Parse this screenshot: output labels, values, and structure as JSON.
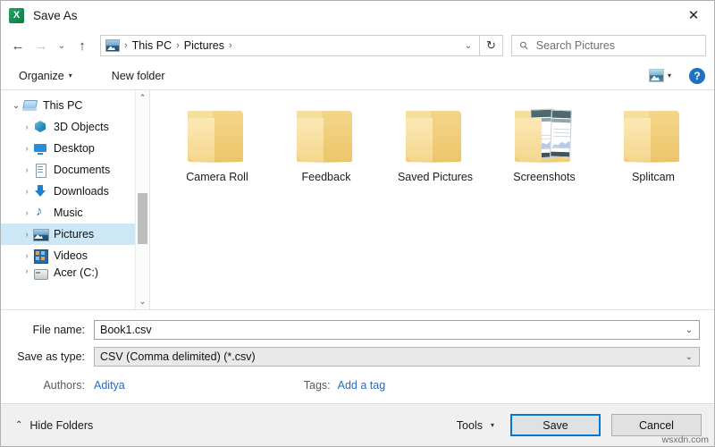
{
  "window": {
    "title": "Save As",
    "app_icon": "excel-icon",
    "close_label": "✕"
  },
  "nav": {
    "back": "←",
    "forward": "→",
    "recent": "⌄",
    "up": "↑",
    "refresh": "↻",
    "address_chevron": "⌄",
    "breadcrumbs": [
      {
        "label": "This PC"
      },
      {
        "label": "Pictures"
      }
    ],
    "separator": "›"
  },
  "search": {
    "placeholder": "Search Pictures",
    "icon": "search-icon"
  },
  "toolbar": {
    "organize_label": "Organize",
    "organize_caret": "▾",
    "new_folder_label": "New folder",
    "view_caret": "▾",
    "help_label": "?"
  },
  "sidebar": {
    "items": [
      {
        "label": "This PC",
        "twisty": "⌄",
        "level": 0,
        "icon": "pc-icon",
        "selected": false
      },
      {
        "label": "3D Objects",
        "twisty": "›",
        "level": 1,
        "icon": "3d-objects-icon",
        "selected": false
      },
      {
        "label": "Desktop",
        "twisty": "›",
        "level": 1,
        "icon": "desktop-icon",
        "selected": false
      },
      {
        "label": "Documents",
        "twisty": "›",
        "level": 1,
        "icon": "documents-icon",
        "selected": false
      },
      {
        "label": "Downloads",
        "twisty": "›",
        "level": 1,
        "icon": "downloads-icon",
        "selected": false
      },
      {
        "label": "Music",
        "twisty": "›",
        "level": 1,
        "icon": "music-icon",
        "selected": false
      },
      {
        "label": "Pictures",
        "twisty": "›",
        "level": 1,
        "icon": "pictures-icon",
        "selected": true
      },
      {
        "label": "Videos",
        "twisty": "›",
        "level": 1,
        "icon": "videos-icon",
        "selected": false
      },
      {
        "label": "Acer (C:)",
        "twisty": "›",
        "level": 1,
        "icon": "drive-icon",
        "selected": false
      }
    ],
    "scroll_up": "⌃",
    "scroll_down": "⌄"
  },
  "files": [
    {
      "name": "Camera Roll",
      "type": "folder"
    },
    {
      "name": "Feedback",
      "type": "folder"
    },
    {
      "name": "Saved Pictures",
      "type": "folder"
    },
    {
      "name": "Screenshots",
      "type": "folder-preview"
    },
    {
      "name": "Splitcam",
      "type": "folder"
    }
  ],
  "form": {
    "file_name_label": "File name:",
    "file_name_value": "Book1.csv",
    "save_type_label": "Save as type:",
    "save_type_value": "CSV (Comma delimited) (*.csv)",
    "dropdown_chevron": "⌄",
    "authors_label": "Authors:",
    "authors_value": "Aditya",
    "tags_label": "Tags:",
    "tags_value": "Add a tag"
  },
  "footer": {
    "hide_folders_label": "Hide Folders",
    "hide_folders_chevron": "⌃",
    "tools_label": "Tools",
    "tools_caret": "▾",
    "save_label": "Save",
    "cancel_label": "Cancel"
  },
  "watermark": "wsxdn.com",
  "colors": {
    "accent": "#0078d7",
    "selection": "#cce8f7",
    "link": "#2a6bbd",
    "folder": "#f0ce7c",
    "excel_green": "#107c41"
  }
}
